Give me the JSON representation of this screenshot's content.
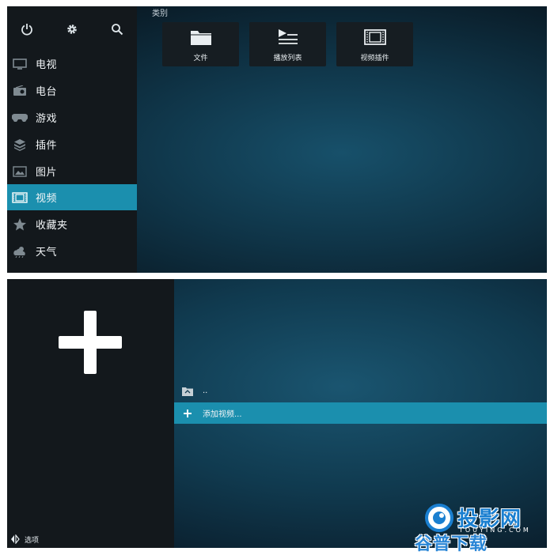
{
  "top_panel": {
    "category_label": "类别",
    "nav": [
      {
        "icon": "tv-icon",
        "label": "电视"
      },
      {
        "icon": "radio-icon",
        "label": "电台"
      },
      {
        "icon": "gamepad-icon",
        "label": "游戏"
      },
      {
        "icon": "addon-box-icon",
        "label": "插件"
      },
      {
        "icon": "picture-icon",
        "label": "图片"
      },
      {
        "icon": "film-icon",
        "label": "视频",
        "active": true
      },
      {
        "icon": "star-icon",
        "label": "收藏夹"
      },
      {
        "icon": "weather-icon",
        "label": "天气"
      }
    ],
    "tiles": [
      {
        "icon": "folder-icon",
        "label": "文件"
      },
      {
        "icon": "playlist-icon",
        "label": "播放列表"
      },
      {
        "icon": "video-addon-icon",
        "label": "视频插件"
      }
    ]
  },
  "bottom_panel": {
    "list": [
      {
        "icon": "parent-folder-icon",
        "label": ".."
      },
      {
        "icon": "plus-icon",
        "label": "添加视频...",
        "active": true
      }
    ],
    "options_label": "选项"
  },
  "watermark": {
    "brand": "投影网",
    "domain": "TOUYING.COM",
    "sub": "谷普下载"
  },
  "colors": {
    "accent": "#1b8fae",
    "sidebar": "#13181c",
    "background": "#0f3447"
  }
}
